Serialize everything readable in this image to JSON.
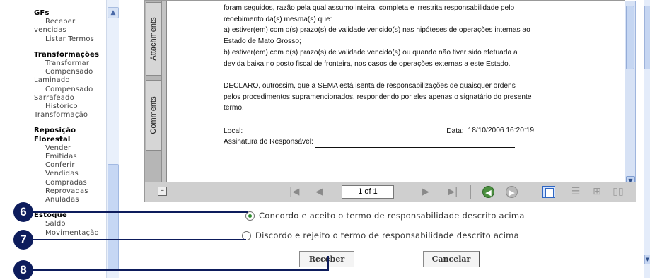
{
  "nav": {
    "sections": [
      {
        "heading": "GFs",
        "items": [
          "Receber",
          "vencidas",
          "Listar Termos"
        ]
      },
      {
        "heading": "Transformações",
        "items": [
          "Transformar",
          "Compensado",
          "Laminado",
          "Compensado",
          "Sarrafeado",
          "Histórico",
          "Transformação"
        ]
      },
      {
        "heading": "Reposição Florestal",
        "items": [
          "Vender",
          "Emitidas",
          "Conferir",
          "Vendidas",
          "Compradas",
          "Reprovadas",
          "Anuladas"
        ]
      },
      {
        "heading": "Estoque",
        "items": [
          "Saldo",
          "Movimentação"
        ]
      }
    ]
  },
  "viewer": {
    "tabs": {
      "attachments": "Attachments",
      "comments": "Comments"
    },
    "document": {
      "lines": [
        "foram seguidos, razão pela qual assumo inteira, completa e irrestrita responsabilidade pelo",
        "reoebimento da(s) mesma(s) que:",
        " a) estiver(em) com o(s) prazo(s) de validade vencido(s) nas hipóteses de operações internas ao",
        "Estado de Mato Grosso;",
        " b) estiver(em) com o(s) prazo(s) de validade vencido(s) ou quando não tiver sido efetuada a",
        "devida baixa no posto fiscal de fronteira, nos casos de operações externas a este Estado.",
        "",
        "DECLARO, outrossim, que a SEMA está isenta de responsabilizações de quaisquer ordens",
        "pelos procedimentos supramencionados, respondendo por eles apenas o signatário do presente",
        "termo.",
        ""
      ],
      "local_label": "Local:",
      "date_label": "Data:",
      "date_value": "18/10/2006 16:20:19",
      "signature_label": "Assinatura do Responsável:"
    },
    "toolbar": {
      "page_indicator": "1 of 1"
    }
  },
  "form": {
    "option_agree": "Concordo e aceito o termo de responsabilidade descrito acima",
    "option_disagree": "Discordo e rejeito o termo de responsabilidade descrito acima",
    "selected": "agree",
    "receber_label": "Receber",
    "cancelar_label": "Cancelar"
  },
  "callouts": [
    "6",
    "7",
    "8"
  ],
  "colors": {
    "callout": "#0d1c5c",
    "selected_radio": "#2d8a2d"
  }
}
